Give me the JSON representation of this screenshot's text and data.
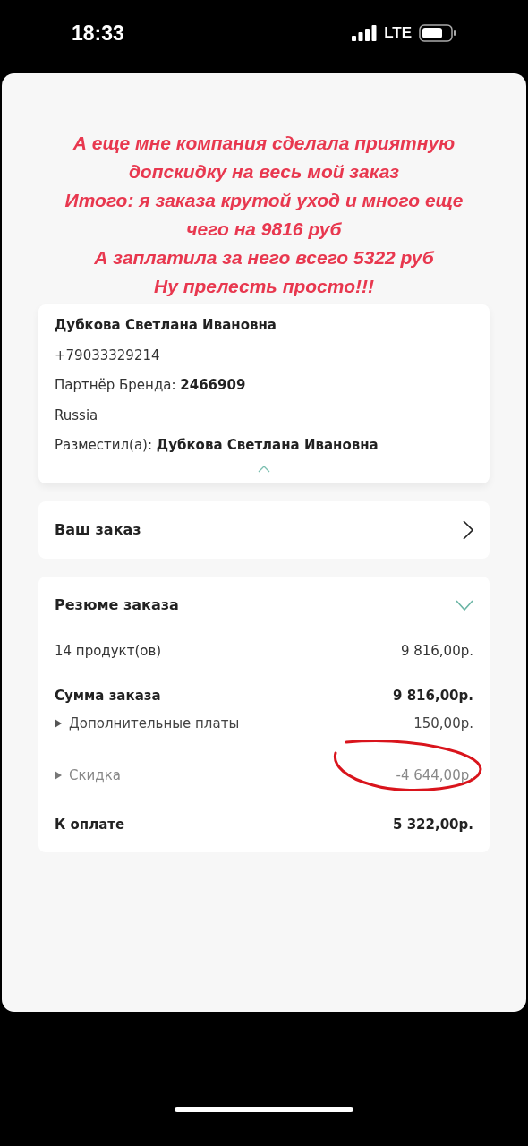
{
  "status_bar": {
    "time": "18:33",
    "network": "LTE"
  },
  "annotation": [
    "А еще мне компания сделала приятную",
    "допскидку на весь мой заказ",
    "Итого: я заказа крутой уход и много еще",
    "чего на **9816** руб",
    "А заплатила за него всего **5322** руб",
    "Ну прелесть просто!!!"
  ],
  "customer": {
    "name": "Дубкова Светлана Ивановна",
    "phone": "+79033329214",
    "partner_label": "Партнёр Бренда:",
    "partner_id": "2466909",
    "country": "Russia",
    "placed_by_label": "Разместил(а):",
    "placed_by": "Дубкова Светлана Ивановна",
    "expanded": true
  },
  "order_link": {
    "label": "Ваш заказ"
  },
  "summary": {
    "title": "Резюме заказа",
    "expanded": true,
    "rows": [
      {
        "kind": "item",
        "label": "14 продукт(ов)",
        "value": "9 816,00р."
      },
      {
        "kind": "subtotal",
        "label": "Сумма заказа",
        "value": "9 816,00р."
      },
      {
        "kind": "fee",
        "label": "Дополнительные платы",
        "value": "150,00р.",
        "expanded": false
      },
      {
        "kind": "discount",
        "label": "Скидка",
        "value": "-4 644,00р.",
        "expanded": false,
        "circled": true
      },
      {
        "kind": "total",
        "label": "К оплате",
        "value": "5 322,00р."
      }
    ]
  }
}
